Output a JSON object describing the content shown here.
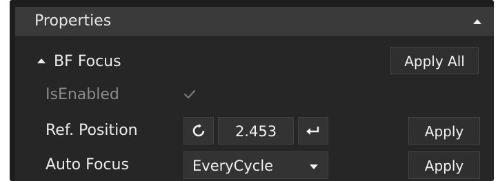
{
  "panel": {
    "title": "Properties",
    "collapse_icon": "caret-up-icon"
  },
  "section": {
    "title": "BF Focus",
    "apply_all_label": "Apply All"
  },
  "rows": {
    "is_enabled": {
      "label": "IsEnabled",
      "checked": true,
      "disabled": true
    },
    "ref_position": {
      "label": "Ref. Position",
      "value": "2.453",
      "refresh_icon": "refresh-icon",
      "enter_icon": "enter-return-icon",
      "apply_label": "Apply"
    },
    "auto_focus": {
      "label": "Auto Focus",
      "selected": "EveryCycle",
      "apply_label": "Apply"
    }
  },
  "colors": {
    "panel_bg": "#1d1d1d",
    "header_bg": "#3a3a3a",
    "section_bg": "#262626",
    "text": "#ececec",
    "disabled_text": "#8a8a8a"
  }
}
